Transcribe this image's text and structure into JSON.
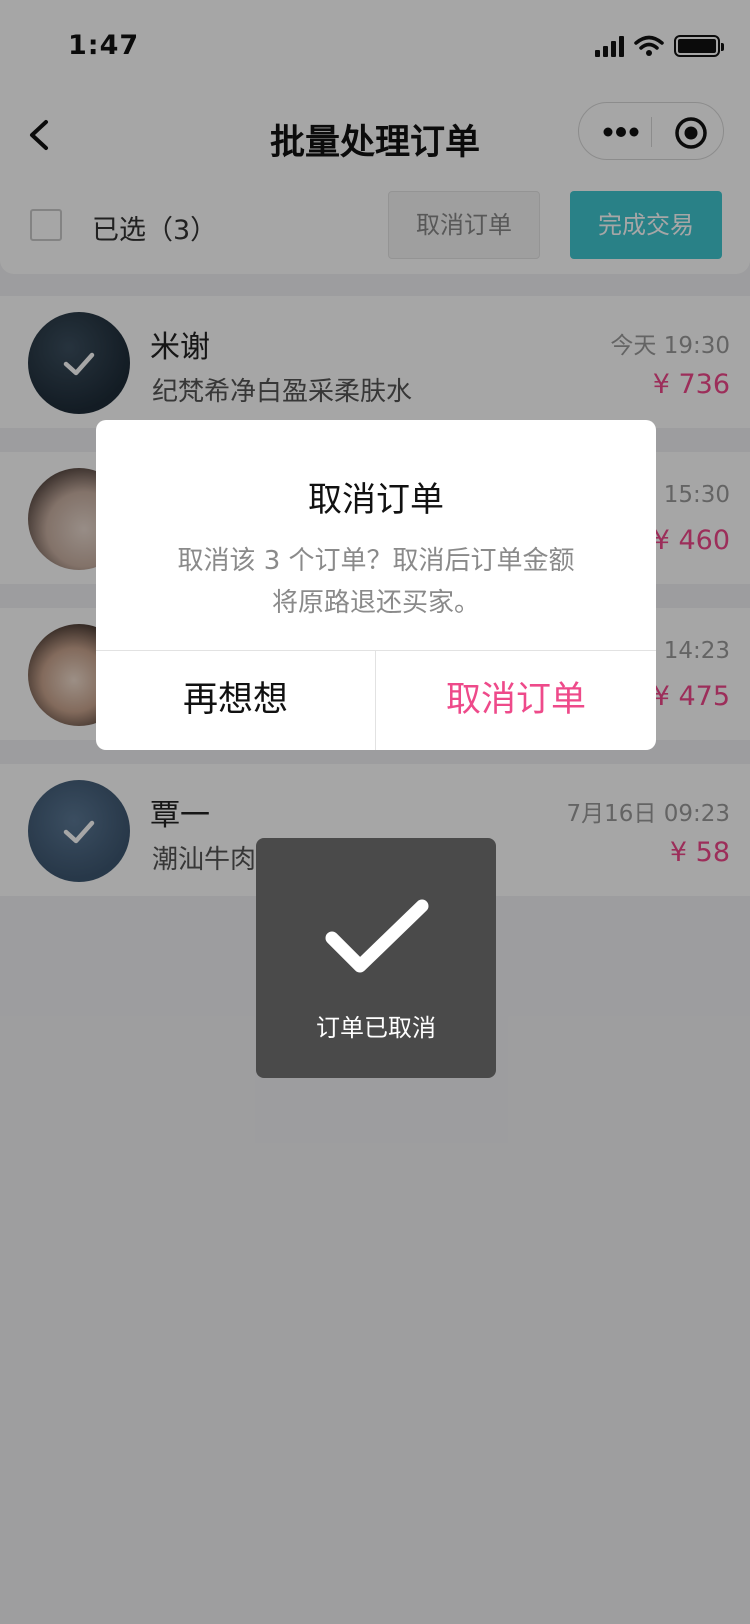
{
  "status_bar": {
    "time": "1:47"
  },
  "nav": {
    "title": "批量处理订单"
  },
  "toolbar": {
    "selected_label": "已选（3）",
    "cancel_label": "取消订单",
    "complete_label": "完成交易"
  },
  "orders": [
    {
      "name": "米谢",
      "product": "纪梵希净白盈采柔肤水",
      "time": "今天 19:30",
      "price": "¥ 736",
      "selected": true
    },
    {
      "name": "",
      "product": "",
      "time": "15:30",
      "price": "¥ 460",
      "selected": false
    },
    {
      "name": "",
      "product": "",
      "time": "14:23",
      "price": "¥ 475",
      "selected": false
    },
    {
      "name": "覃一",
      "product": "潮汕牛肉丸",
      "time": "7月16日 09:23",
      "price": "¥ 58",
      "selected": true
    }
  ],
  "dialog": {
    "title": "取消订单",
    "body_line1": "取消该 3 个订单？取消后订单金额",
    "body_line2": "将原路退还买家。",
    "left_button": "再想想",
    "right_button": "取消订单"
  },
  "toast": {
    "text": "订单已取消"
  },
  "colors": {
    "accent_teal": "#3fc6cf",
    "price_pink": "#f0478a",
    "confirm_pink": "#ee4a8a"
  }
}
